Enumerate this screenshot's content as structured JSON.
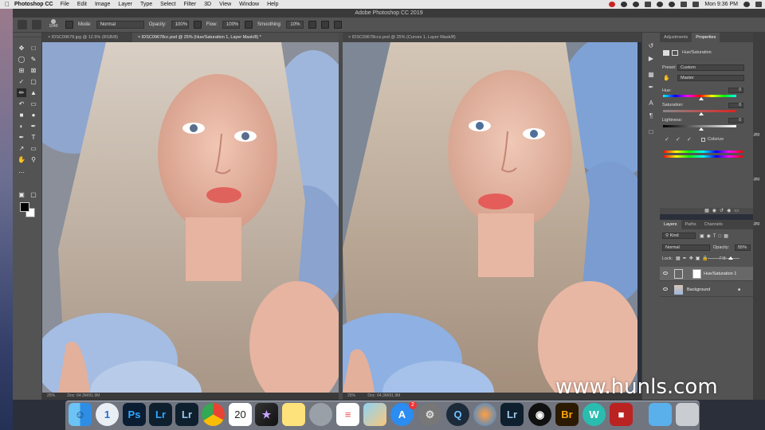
{
  "menubar": {
    "app_name": "Photoshop CC",
    "items": [
      "File",
      "Edit",
      "Image",
      "Layer",
      "Type",
      "Select",
      "Filter",
      "3D",
      "View",
      "Window",
      "Help"
    ],
    "clock": "Mon 9:36 PM"
  },
  "window": {
    "title": "Adobe Photoshop CC 2019"
  },
  "options": {
    "brush_size": "1040",
    "mode_label": "Mode:",
    "mode_value": "Normal",
    "opacity_label": "Opacity:",
    "opacity_value": "100%",
    "flow_label": "Flow:",
    "flow_value": "100%",
    "smoothing_label": "Smoothing:",
    "smoothing_value": "10%"
  },
  "documents": [
    {
      "tab": "IDSC09678.jpg @ 12.5% (RGB/8)",
      "active": false
    },
    {
      "tab": "IDSC09678cc.psd @ 25% (Hue/Saturation 1, Layer Mask/8) *",
      "active": true
    },
    {
      "tab": "IDSC09678ccs.psd @ 25% (Curves 1, Layer Mask/8)",
      "active": false
    }
  ],
  "status": {
    "left_zoom": "25%",
    "left_doc": "Doc: 64.3M/91.9M",
    "right_zoom": "25%",
    "right_doc": "Doc: 64.3M/91.9M"
  },
  "panels": {
    "top_tabs": [
      "Adjustments",
      "Properties"
    ],
    "adjustment_name": "Hue/Saturation",
    "preset_label": "Preset:",
    "preset_value": "Custom",
    "channel_value": "Master",
    "hue_label": "Hue:",
    "hue_value": "0",
    "saturation_label": "Saturation:",
    "saturation_value": "0",
    "lightness_label": "Lightness:",
    "lightness_value": "0",
    "colorize_label": "Colorize",
    "layer_tabs": [
      "Layers",
      "Paths",
      "Channels"
    ],
    "kind_label": "Kind",
    "blend_mode": "Normal",
    "opacity_label": "Opacity:",
    "opacity_value": "55%",
    "lock_label": "Lock:",
    "fill_label": "Fill:",
    "layers": [
      {
        "name": "Hue/Saturation 1",
        "selected": true
      },
      {
        "name": "Background",
        "selected": false
      }
    ]
  },
  "right_edge_files": [
    ".jpg",
    ".jpg",
    ".jpg"
  ],
  "watermark": "www.hunls.com",
  "dock": [
    "Finder",
    "1Password",
    "Photoshop",
    "Lightroom",
    "Lightroom Classic",
    "Chrome",
    "Calendar",
    "Final Cut Pro",
    "Notes",
    "Screenshot",
    "Reminders",
    "Preview",
    "App Store",
    "System Preferences",
    "QuickTime",
    "Network Radar",
    "Lightroom",
    "OBS",
    "Bridge",
    "W",
    "Dictionary",
    "Folder",
    "Trash"
  ],
  "calendar_day": "20",
  "app_store_badge": "2"
}
